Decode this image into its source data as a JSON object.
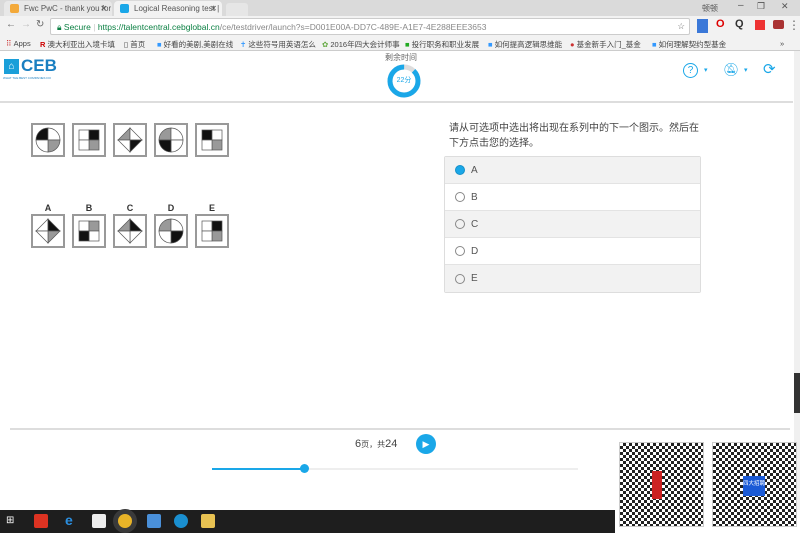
{
  "browser": {
    "tabs": [
      {
        "label": "Fwc PwC - thank you for",
        "active": false
      },
      {
        "label": "Logical Reasoning test |",
        "active": true
      }
    ],
    "window_user": "顿顿",
    "secure_label": "Secure",
    "url_host": "https://talentcentral.cebglobal.cn",
    "url_path": "/ce/testdriver/launch?s=D001E00A-DD7C-489E-A1E7-4E288EEE3653",
    "bookmarks": [
      "Apps",
      "澳大利亚出入境卡填",
      "首页",
      "好看的美剧,美剧在线",
      "这些符号用英语怎么",
      "2016年四大会计师事",
      "投行职务和职业发展",
      "如何提高逻辑思维能",
      "基金新手入门_基金",
      "如何理解契约型基金"
    ]
  },
  "header": {
    "logo": "CEB",
    "logo_tagline": "WHAT THE BEST COMPANIES DO",
    "timer_label": "剩余时间",
    "timer_value": "22分",
    "timer_fraction_remaining": 0.88,
    "accent": "#1aa7e8"
  },
  "series": [
    {
      "shape": "circle",
      "fills": [
        "black",
        "white",
        "gray",
        "white"
      ]
    },
    {
      "shape": "square",
      "fills": [
        "white",
        "black",
        "gray",
        "white"
      ]
    },
    {
      "shape": "diamond",
      "fills": [
        "gray",
        "white",
        "black",
        "white"
      ]
    },
    {
      "shape": "circle",
      "fills": [
        "gray",
        "white",
        "white",
        "black"
      ]
    },
    {
      "shape": "square",
      "fills": [
        "black",
        "white",
        "gray",
        "white"
      ]
    }
  ],
  "answers": [
    {
      "label": "A",
      "shape": "diamond",
      "fills": [
        "white",
        "black",
        "gray",
        "white"
      ]
    },
    {
      "label": "B",
      "shape": "square",
      "fills": [
        "white",
        "gray",
        "white",
        "black"
      ]
    },
    {
      "label": "C",
      "shape": "diamond",
      "fills": [
        "gray",
        "black",
        "white",
        "white"
      ]
    },
    {
      "label": "D",
      "shape": "circle",
      "fills": [
        "gray",
        "white",
        "black",
        "white"
      ]
    },
    {
      "label": "E",
      "shape": "square",
      "fills": [
        "white",
        "black",
        "gray",
        "white"
      ]
    }
  ],
  "question": "请从可选项中选出将出现在系列中的下一个图示。然后在下方点击您的选择。",
  "options": [
    {
      "label": "A",
      "selected": true
    },
    {
      "label": "B",
      "selected": false
    },
    {
      "label": "C",
      "selected": false
    },
    {
      "label": "D",
      "selected": false
    },
    {
      "label": "E",
      "selected": false
    }
  ],
  "pager": {
    "current": "6",
    "sep1": "页，共",
    "total": "24",
    "progress": 0.25
  },
  "qr_badges": [
    "四大招聘"
  ]
}
